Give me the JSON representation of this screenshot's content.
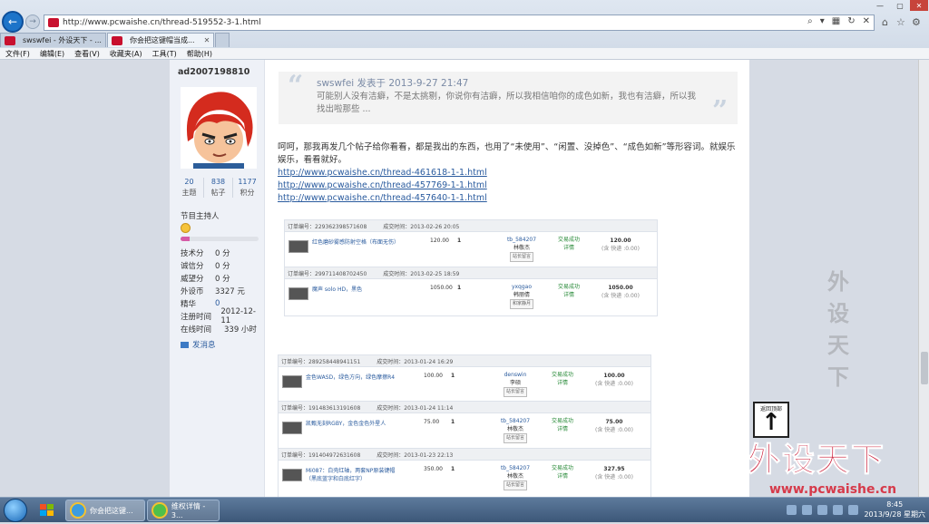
{
  "browser": {
    "url": "http://www.pcwaishe.cn/thread-519552-3-1.html",
    "tabs": [
      {
        "label": "swswfei - 外设天下 - ..."
      },
      {
        "label": "你会把这键帽当成..."
      }
    ],
    "menu": [
      "文件(F)",
      "编辑(E)",
      "查看(V)",
      "收藏夹(A)",
      "工具(T)",
      "帮助(H)"
    ]
  },
  "profile": {
    "username": "ad2007198810",
    "stats": [
      {
        "value": "20",
        "label": "主题"
      },
      {
        "value": "838",
        "label": "帖子"
      },
      {
        "value": "1177",
        "label": "积分"
      }
    ],
    "role": "节目主持人",
    "level_progress": 0.12,
    "attributes": [
      {
        "key": "技术分",
        "value": "0 分"
      },
      {
        "key": "诚信分",
        "value": "0 分"
      },
      {
        "key": "威望分",
        "value": "0 分"
      },
      {
        "key": "外设币",
        "value": "3327 元"
      },
      {
        "key": "精华",
        "value": "0"
      },
      {
        "key": "注册时间",
        "value": "2012-12-11"
      },
      {
        "key": "在线时间",
        "value": "339 小时"
      }
    ],
    "message_link": "发消息"
  },
  "post": {
    "quote_header": "swswfei 发表于 2013-9-27 21:47",
    "quote_body": "可能别人没有洁癖，不是太挑剔，你说你有洁癖，所以我相信咱你的成色如新，我也有洁癖，所以我找出啦那些 ...",
    "body": "呵呵，那我再发几个帖子给你看看，都是我出的东西，也用了“未使用”、“闲置、没掉色”、“成色如新”等形容词。就娱乐娱乐，看看就好。",
    "links": [
      "http://www.pcwaishe.cn/thread-461618-1-1.html",
      "http://www.pcwaishe.cn/thread-457769-1-1.html",
      "http://www.pcwaishe.cn/thread-457640-1-1.html"
    ]
  },
  "orders": [
    {
      "no": "订单编号：229362398571608",
      "time": "成交时间：2013-02-26 20:05",
      "item": "红色磨砂雾感防射空格（布面无伤）",
      "price": "120.00",
      "qty": "1",
      "seller": "tb_584207",
      "buyer": "林敬杰",
      "tag": "站长留言",
      "status": "交易成功",
      "detail": "详情",
      "total": "120.00",
      "ship": "(含 快递 :0.00)"
    },
    {
      "no": "订单编号：299711408702450",
      "time": "成交时间：2013-02-25 18:59",
      "item": "魔声 solo HD，黑色",
      "price": "1050.00",
      "qty": "1",
      "seller": "yxqgao",
      "buyer": "韩丽倩",
      "tag": "和家静月",
      "status": "交易成功",
      "detail": "详情",
      "total": "1050.00",
      "ship": "(含 快递 :0.00)"
    },
    {
      "no": "订单编号：289258448941151",
      "time": "成交时间：2013-01-24 16:29",
      "item": "金色WASD，绿色方向，绿色摩擦R4",
      "price": "100.00",
      "qty": "1",
      "seller": "denswin",
      "buyer": "李硕",
      "tag": "站长留言",
      "status": "交易成功",
      "detail": "详情",
      "total": "100.00",
      "ship": "(含 快递 :0.00)"
    },
    {
      "no": "订单编号：191483613191608",
      "time": "成交时间：2013-01-24 11:14",
      "item": "凯甄无刻RGBY，金色金色外星人",
      "price": "75.00",
      "qty": "1",
      "seller": "tb_584207",
      "buyer": "林敬杰",
      "tag": "站长留言",
      "status": "交易成功",
      "detail": "详情",
      "total": "75.00",
      "ship": "(含 快递 :0.00)"
    },
    {
      "no": "订单编号：191404972631608",
      "time": "成交时间：2013-01-23 22:13",
      "item": "Mi087：白壳红轴，两套NP原装键帽（黑底蓝字和白底红字）",
      "price": "350.00",
      "qty": "1",
      "seller": "tb_584207",
      "buyer": "林敬杰",
      "tag": "站长留言",
      "status": "交易成功",
      "detail": "详情",
      "total": "327.95",
      "ship": "(含 快递 :0.00)"
    }
  ],
  "overlay": {
    "back_to_top": "返回顶部",
    "watermark": "外设天下",
    "brand": "外设天下",
    "brand_url": "www.pcwaishe.cn"
  },
  "taskbar": {
    "tasks": [
      {
        "label": "你会把这键..."
      },
      {
        "label": "维权详情 - 3..."
      }
    ],
    "time": "8:45",
    "date": "2013/9/28 星期六"
  }
}
